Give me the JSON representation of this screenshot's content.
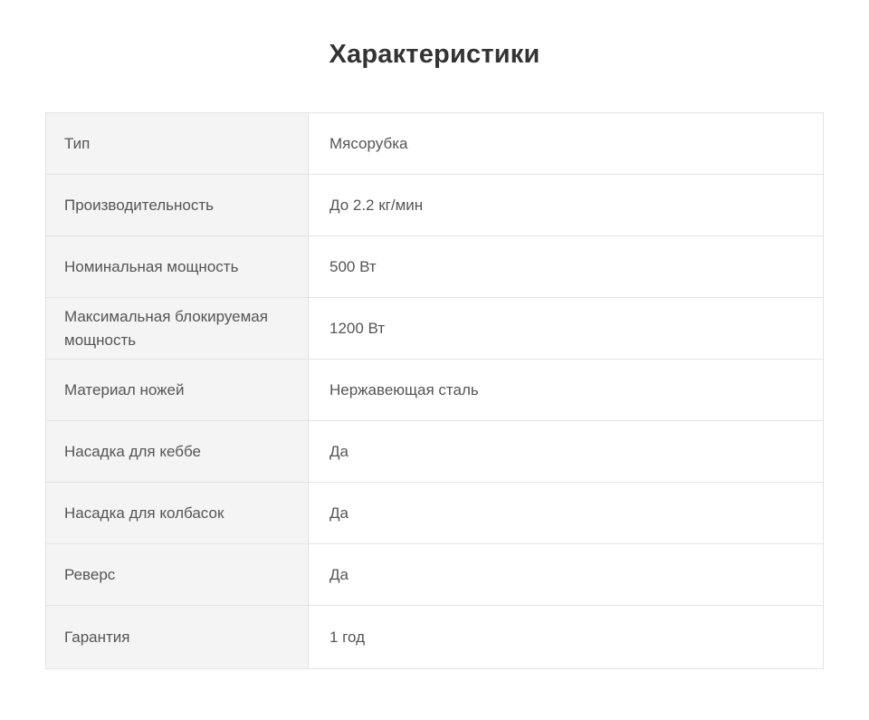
{
  "page": {
    "title": "Характеристики"
  },
  "specs": {
    "rows": [
      {
        "key": "Тип",
        "value": "Мясорубка"
      },
      {
        "key": "Производительность",
        "value": "До 2.2 кг/мин"
      },
      {
        "key": "Номинальная мощность",
        "value": "500 Вт"
      },
      {
        "key": "Максимальная блокируемая мощность",
        "value": "1200 Вт"
      },
      {
        "key": "Материал ножей",
        "value": "Нержавеющая сталь"
      },
      {
        "key": "Насадка для кеббе",
        "value": "Да"
      },
      {
        "key": "Насадка для колбасок",
        "value": "Да"
      },
      {
        "key": "Реверс",
        "value": "Да"
      },
      {
        "key": "Гарантия",
        "value": "1 год"
      }
    ]
  },
  "colors": {
    "title": "#333333",
    "text": "#555555",
    "key_cell_bg": "#f4f4f4",
    "border": "#e3e3e3"
  }
}
